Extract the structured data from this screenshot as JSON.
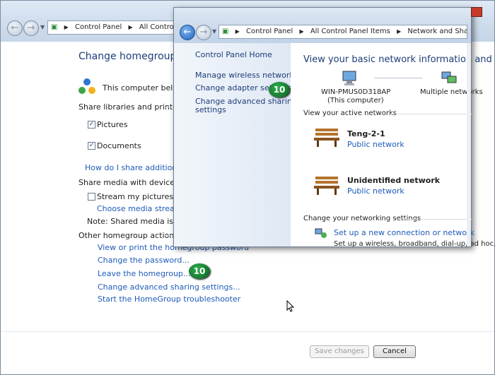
{
  "back_window": {
    "breadcrumb": [
      "Control Panel",
      "All Control Pan"
    ],
    "title": "Change homegroup set",
    "member_text": "This computer belongs",
    "share_libraries_heading": "Share libraries and printers",
    "libraries": [
      {
        "label": "Pictures",
        "checked": true
      },
      {
        "label": "Documents",
        "checked": true
      }
    ],
    "share_help_link": "How do I share additional libr",
    "share_media_heading": "Share media with devices",
    "stream_label": "Stream my pictures, music",
    "stream_checked": false,
    "choose_media_link": "Choose media streaming",
    "note_text": "Note: Shared media is not se",
    "other_actions_heading": "Other homegroup actions",
    "actions": [
      "View or print the homegroup password",
      "Change the password...",
      "Leave the homegroup...",
      "Change advanced sharing settings...",
      "Start the HomeGroup troubleshooter"
    ],
    "save_button": "Save changes",
    "cancel_button": "Cancel",
    "badge": "10"
  },
  "front_window": {
    "breadcrumb": [
      "Control Panel",
      "All Control Panel Items",
      "Network and Sharing Center"
    ],
    "left_links": {
      "home": "Control Panel Home",
      "wireless": "Manage wireless networks",
      "adapter": "Change adapter settings",
      "advanced_line1": "Change advanced sharing",
      "advanced_line2": "settings"
    },
    "badge": "10",
    "heading": "View your basic network information and se",
    "computer_name": "WIN-PMUS0D318AP",
    "computer_sub": "(This computer)",
    "multiple_networks": "Multiple networks",
    "active_networks_label": "View your active networks",
    "networks": [
      {
        "name": "Teng-2-1",
        "type": "Public network"
      },
      {
        "name": "Unidentified network",
        "type": "Public network"
      }
    ],
    "change_settings_label": "Change your networking settings",
    "setup_link": "Set up a new connection or network",
    "setup_desc": "Set up a wireless, broadband, dial-up, ad hoc, o"
  }
}
